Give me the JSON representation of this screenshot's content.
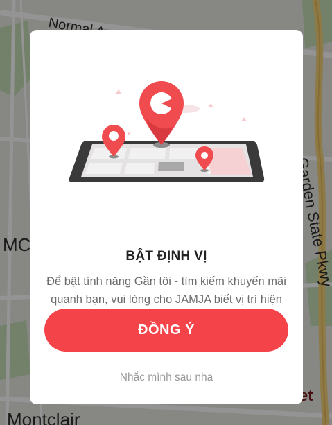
{
  "map": {
    "labels": {
      "street_top": "Normal Ave",
      "area_left": "MC",
      "town_bottom": "Montclair",
      "parkway": "Garden State Pkwy",
      "partial_right": "et"
    }
  },
  "dialog": {
    "illustration_icon": "phone-map-location-pin-illustration",
    "title": "BẬT ĐỊNH VỊ",
    "message": "Để bật tính năng Gần tôi - tìm kiếm khuyến mãi quanh bạn, vui lòng cho JAMJA biết vị trí hiện tại của bạn nhé!",
    "agree_label": "ĐỒNG Ý",
    "later_label": "Nhắc mình sau nha"
  },
  "colors": {
    "accent": "#f4444a",
    "title": "#222222",
    "body_text": "#6b6b6b",
    "muted_text": "#9a9a9a"
  }
}
